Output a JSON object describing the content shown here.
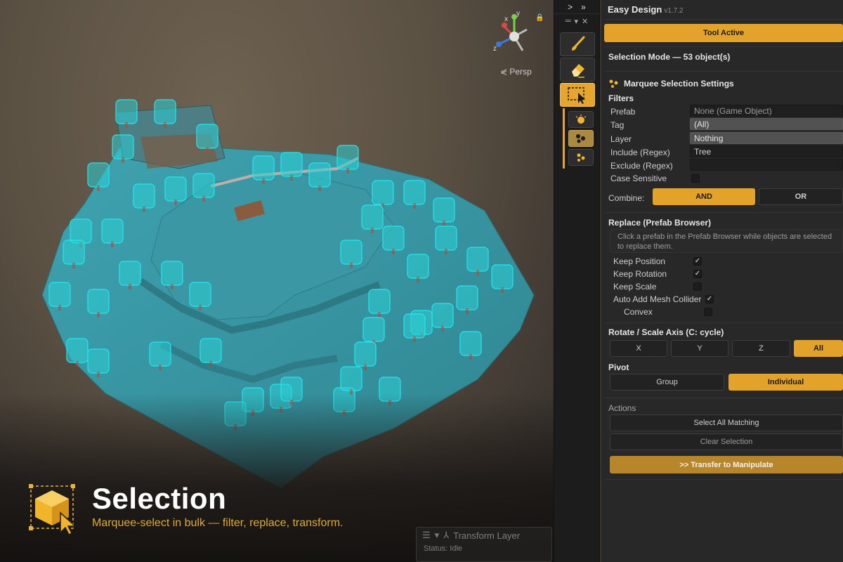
{
  "scene": {
    "view_label": "⋞ Persp",
    "gizmo_axes": {
      "x": "x",
      "y": "y",
      "z": "z"
    },
    "overlay": {
      "title": "Selection",
      "subtitle": "Marquee-select in bulk — filter, replace, transform."
    },
    "transform_layer": {
      "title": "Transform Layer",
      "status": "Status: Idle"
    }
  },
  "toolbar": {
    "top_glyphs": [
      ">",
      "»"
    ],
    "tools": [
      {
        "name": "brush-tool",
        "icon": "paint-brush-icon",
        "active": false
      },
      {
        "name": "eraser-tool",
        "icon": "eraser-icon",
        "active": false
      },
      {
        "name": "selection-tool",
        "icon": "marquee-cursor-icon",
        "active": true
      }
    ],
    "sub_tools": [
      {
        "name": "single-select",
        "icon": "star-burst-icon",
        "active": false
      },
      {
        "name": "marquee-select",
        "icon": "scatter-dots-icon",
        "active": true
      },
      {
        "name": "scatter-select",
        "icon": "scatter-dots-small-icon",
        "active": false
      }
    ]
  },
  "panel": {
    "title": "Easy Design",
    "version": "v1.7.2",
    "tool_active": "Tool Active",
    "mode": "Selection Mode — 53 object(s)",
    "marquee_header": "Marquee Selection Settings",
    "filters": {
      "heading": "Filters",
      "prefab": {
        "label": "Prefab",
        "value": "None (Game Object)"
      },
      "tag": {
        "label": "Tag",
        "value": "(All)"
      },
      "layer": {
        "label": "Layer",
        "value": "Nothing"
      },
      "include": {
        "label": "Include (Regex)",
        "value": "Tree"
      },
      "exclude": {
        "label": "Exclude (Regex)",
        "value": ""
      },
      "case_sensitive": {
        "label": "Case Sensitive",
        "checked": false
      }
    },
    "combine": {
      "label": "Combine:",
      "options": [
        "AND",
        "OR"
      ],
      "selected": "AND"
    },
    "replace": {
      "heading": "Replace (Prefab Browser)",
      "hint": "Click a prefab in the Prefab Browser while objects are selected to replace them.",
      "options": [
        {
          "label": "Keep Position",
          "checked": true
        },
        {
          "label": "Keep Rotation",
          "checked": true
        },
        {
          "label": "Keep Scale",
          "checked": false
        },
        {
          "label": "Auto Add Mesh Collider",
          "checked": true
        },
        {
          "label": "Convex",
          "checked": false
        }
      ]
    },
    "axis": {
      "heading": "Rotate / Scale Axis (C: cycle)",
      "options": [
        "X",
        "Y",
        "Z",
        "All"
      ],
      "selected": "All"
    },
    "pivot": {
      "heading": "Pivot",
      "options": [
        "Group",
        "Individual"
      ],
      "selected": "Individual"
    },
    "actions": {
      "heading": "Actions",
      "select_all": "Select All Matching",
      "clear": "Clear Selection",
      "transfer": ">> Transfer to Manipulate"
    }
  },
  "colors": {
    "accent": "#e3a22a",
    "selection_outline": "#22e6f0",
    "water": "#3c9aa8"
  }
}
